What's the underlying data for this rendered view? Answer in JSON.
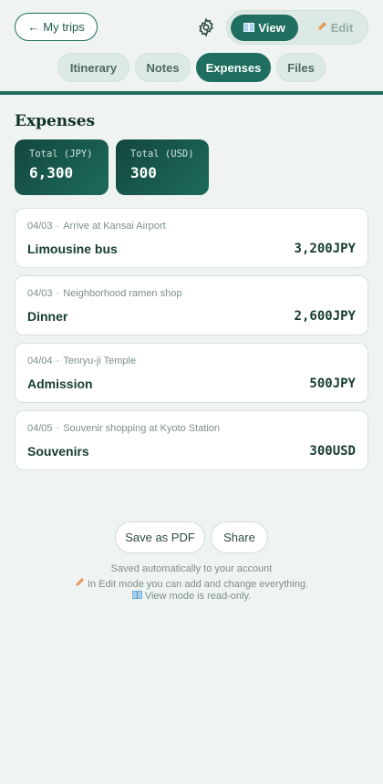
{
  "header": {
    "back_label": "My trips",
    "mode_view": "View",
    "mode_edit": "Edit"
  },
  "tabs": [
    {
      "label": "Itinerary"
    },
    {
      "label": "Notes"
    },
    {
      "label": "Expenses"
    },
    {
      "label": "Files"
    }
  ],
  "expenses": {
    "title": "Expenses",
    "totals": [
      {
        "label": "Total (JPY)",
        "value": "6,300"
      },
      {
        "label": "Total (USD)",
        "value": "300"
      }
    ],
    "items": [
      {
        "date": "04/03",
        "sep": "·",
        "place": "Arrive at Kansai Airport",
        "name": "Limousine bus",
        "amount": "3,200",
        "currency": "JPY"
      },
      {
        "date": "04/03",
        "sep": "·",
        "place": "Neighborhood ramen shop",
        "name": "Dinner",
        "amount": "2,600",
        "currency": "JPY"
      },
      {
        "date": "04/04",
        "sep": "·",
        "place": "Tenryu-ji Temple",
        "name": "Admission",
        "amount": "500",
        "currency": "JPY"
      },
      {
        "date": "04/05",
        "sep": "·",
        "place": "Souvenir shopping at Kyoto Station",
        "name": "Souvenirs",
        "amount": "300",
        "currency": "USD"
      }
    ]
  },
  "actions": {
    "save_pdf": "Save as PDF",
    "share": "Share"
  },
  "footer": {
    "line1": "Saved automatically to your account",
    "line2": "In Edit mode you can add and change everything.",
    "line3": "View mode is read-only."
  },
  "colors": {
    "accent": "#1f6e5f",
    "background": "#eff4f2"
  },
  "icons": {
    "back": "arrow-left-icon",
    "settings": "gear-icon",
    "view": "book-icon",
    "edit": "pencil-icon"
  }
}
